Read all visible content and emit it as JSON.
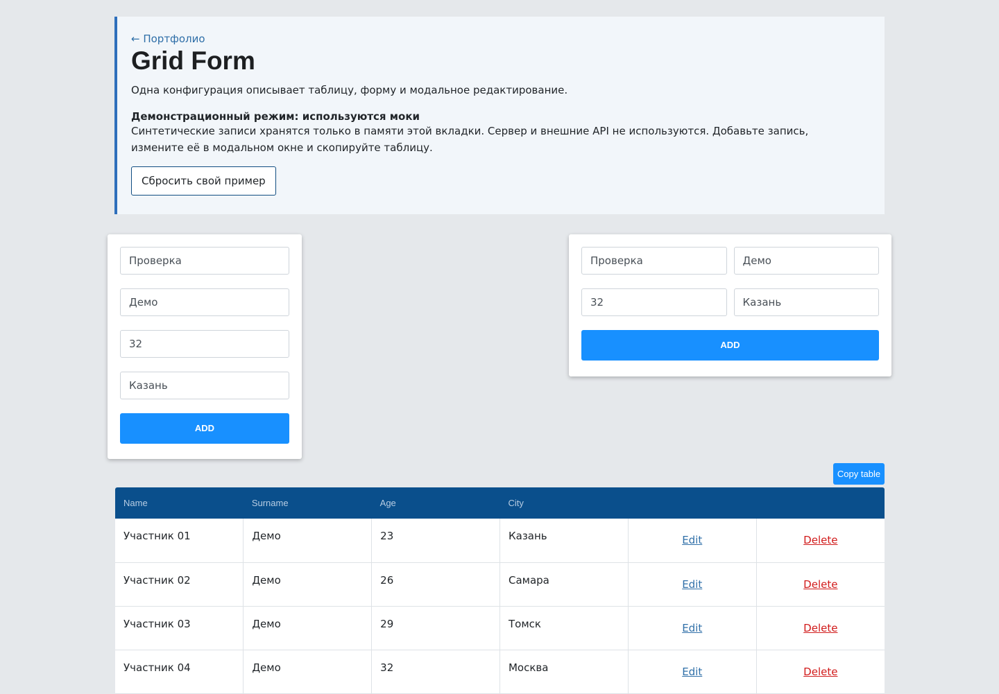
{
  "header": {
    "back_link": "← Портфолио",
    "title": "Grid Form",
    "subtitle": "Одна конфигурация описывает таблицу, форму и модальное редактирование.",
    "notice_title": "Демонстрационный режим: используются моки",
    "notice_text": "Синтетические записи хранятся только в памяти этой вкладки. Сервер и внешние API не используются. Добавьте запись, измените её в модальном окне и скопируйте таблицу.",
    "reset_label": "Сбросить свой пример"
  },
  "form_left": {
    "name": "Проверка",
    "surname": "Демо",
    "age": "32",
    "city": "Казань",
    "add_label": "ADD"
  },
  "form_right": {
    "name": "Проверка",
    "surname": "Демо",
    "age": "32",
    "city": "Казань",
    "add_label": "ADD"
  },
  "copy_label": "Copy table",
  "table": {
    "headers": [
      "Name",
      "Surname",
      "Age",
      "City",
      "",
      ""
    ],
    "rows": [
      {
        "name": "Участник 01",
        "surname": "Демо",
        "age": "23",
        "city": "Казань",
        "edit": "Edit",
        "delete": "Delete"
      },
      {
        "name": "Участник 02",
        "surname": "Демо",
        "age": "26",
        "city": "Самара",
        "edit": "Edit",
        "delete": "Delete"
      },
      {
        "name": "Участник 03",
        "surname": "Демо",
        "age": "29",
        "city": "Томск",
        "edit": "Edit",
        "delete": "Delete"
      },
      {
        "name": "Участник 04",
        "surname": "Демо",
        "age": "32",
        "city": "Москва",
        "edit": "Edit",
        "delete": "Delete"
      }
    ]
  },
  "colors": {
    "accent": "#1890ff",
    "table_header": "#0a4f8c",
    "banner_border": "#2f6fbb",
    "delete": "#d11a1a"
  }
}
